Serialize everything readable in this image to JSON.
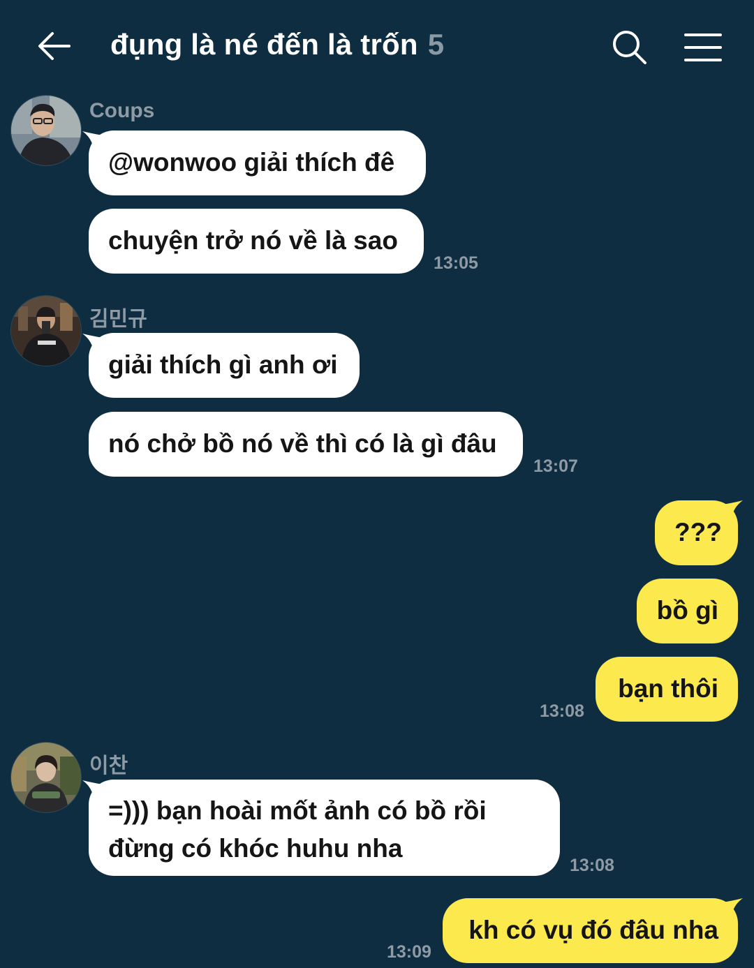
{
  "header": {
    "title": "đụng là né đến là trốn",
    "member_count": "5",
    "back_icon": "arrow-left-icon",
    "search_icon": "search-icon",
    "menu_icon": "hamburger-menu-icon"
  },
  "colors": {
    "background": "#0f2d40",
    "incoming_bubble": "#ffffff",
    "outgoing_bubble": "#fbe94e",
    "meta_text": "#8e9ba5"
  },
  "messages": [
    {
      "sender": "Coups",
      "bubbles": [
        "@wonwoo giải thích đê",
        "chuyện trở nó về là sao"
      ],
      "time": "13:05"
    },
    {
      "sender": "김민규",
      "bubbles": [
        "giải thích gì anh ơi",
        "nó chở bồ nó về thì có là gì đâu"
      ],
      "time": "13:07"
    },
    {
      "sender": "me",
      "bubbles": [
        "???",
        "bồ gì",
        "bạn thôi"
      ],
      "time": "13:08"
    },
    {
      "sender": "이찬",
      "bubbles": [
        [
          "=))) bạn hoài mốt ảnh có bồ rồi",
          "đừng có khóc huhu nha"
        ]
      ],
      "time": "13:08"
    },
    {
      "sender": "me",
      "bubbles": [
        "kh có vụ đó đâu nha"
      ],
      "time": "13:09"
    }
  ]
}
